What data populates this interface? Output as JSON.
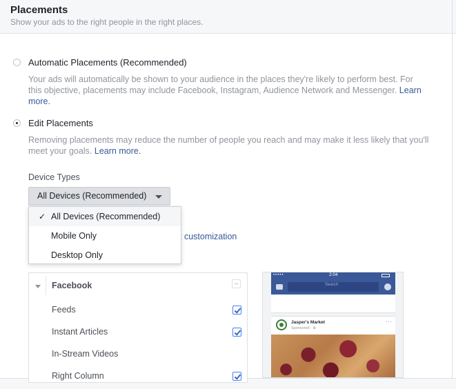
{
  "header": {
    "title": "Placements",
    "subtitle": "Show your ads to the right people in the right places."
  },
  "options": {
    "automatic": {
      "label": "Automatic Placements (Recommended)",
      "desc_line1": "Your ads will automatically be shown to your audience in the places they're likely to perform best. For",
      "desc_line2_text": "this objective, placements may include Facebook, Instagram, Audience Network and Messenger.",
      "desc_link_part1": "Learn",
      "desc_link_part2": "more.",
      "selected": false
    },
    "edit": {
      "label": "Edit Placements",
      "desc_line1": "Removing placements may reduce the number of people you reach and may make it less likely that you'll",
      "desc_line2_text": "meet your goals.",
      "desc_link": "Learn more.",
      "selected": true
    }
  },
  "device_types": {
    "label": "Device Types",
    "selected": "All Devices (Recommended)",
    "options": [
      {
        "label": "All Devices (Recommended)",
        "checked": true
      },
      {
        "label": "Mobile Only",
        "checked": false
      },
      {
        "label": "Desktop Only",
        "checked": false
      }
    ],
    "check_glyph": "✓"
  },
  "customization_link": "t customization",
  "platforms": {
    "facebook": {
      "name": "Facebook",
      "state": "indeterminate",
      "items": [
        {
          "label": "Feeds",
          "checked": true
        },
        {
          "label": "Instant Articles",
          "checked": true
        },
        {
          "label": "In-Stream Videos",
          "checked": false
        },
        {
          "label": "Right Column",
          "checked": true
        }
      ]
    }
  },
  "preview": {
    "status_time": "2:04",
    "search_placeholder": "Search",
    "advertiser": "Jasper's Market",
    "sponsored": "Sponsored · ⊕",
    "more": "···",
    "status_dots": "•••••"
  },
  "colors": {
    "link": "#365899",
    "facebook_blue": "#3b5998",
    "checkbox_blue": "#4267b2",
    "muted_text": "#90949c"
  }
}
